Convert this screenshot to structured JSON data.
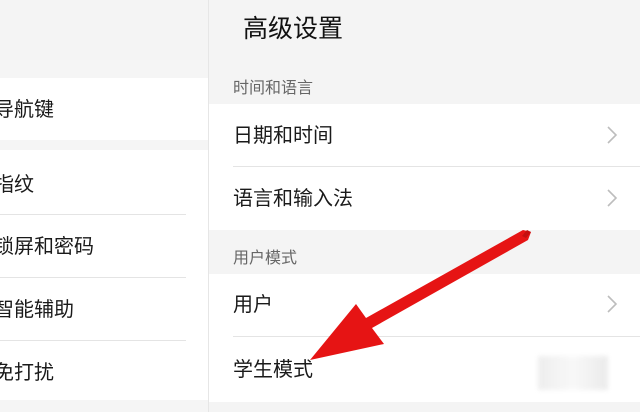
{
  "left_menu": {
    "items": [
      {
        "label": "导航键"
      },
      {
        "label": "指纹"
      },
      {
        "label": "锁屏和密码"
      },
      {
        "label": "智能辅助"
      },
      {
        "label": "免打扰"
      }
    ]
  },
  "header": {
    "title": "高级设置"
  },
  "sections": [
    {
      "label": "时间和语言",
      "rows": [
        {
          "label": "日期和时间",
          "chevron": true
        },
        {
          "label": "语言和输入法",
          "chevron": true
        }
      ]
    },
    {
      "label": "用户模式",
      "rows": [
        {
          "label": "用户",
          "chevron": true
        },
        {
          "label": "学生模式",
          "chevron": false
        }
      ]
    }
  ],
  "icons": {
    "row_chevron": "chevron-right-icon",
    "annotation": "red-arrow-icon"
  },
  "colors": {
    "arrow": "#e61414",
    "background": "#f4f4f4",
    "card": "#ffffff"
  }
}
